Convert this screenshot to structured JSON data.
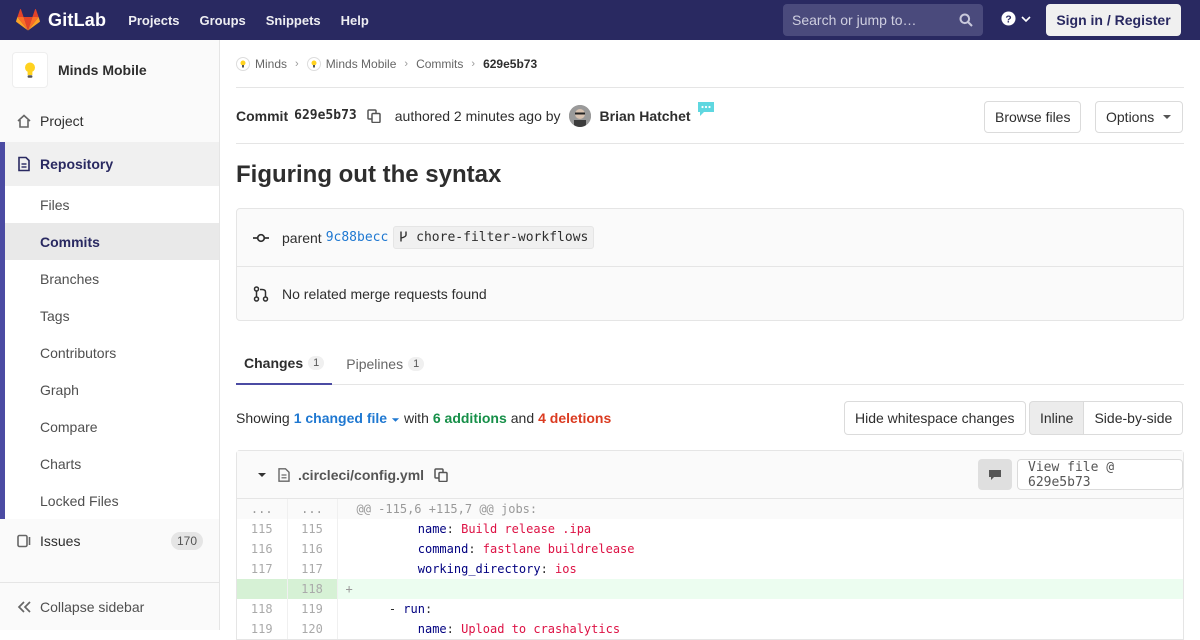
{
  "nav": {
    "brand": "GitLab",
    "links": [
      "Projects",
      "Groups",
      "Snippets",
      "Help"
    ],
    "search_placeholder": "Search or jump to…",
    "signin": "Sign in / Register"
  },
  "sidebar": {
    "project_name": "Minds Mobile",
    "project": "Project",
    "repository": "Repository",
    "repo_items": [
      "Files",
      "Commits",
      "Branches",
      "Tags",
      "Contributors",
      "Graph",
      "Compare",
      "Charts",
      "Locked Files"
    ],
    "active_item": "Commits",
    "issues": "Issues",
    "issues_count": "170",
    "collapse": "Collapse sidebar"
  },
  "breadcrumb": {
    "group": "Minds",
    "project": "Minds Mobile",
    "section": "Commits",
    "current": "629e5b73"
  },
  "commit": {
    "label": "Commit",
    "sha": "629e5b73",
    "authored": "authored 2 minutes ago by",
    "author": "Brian Hatchet",
    "browse_files": "Browse files",
    "options": "Options",
    "title": "Figuring out the syntax",
    "parent_label": "parent",
    "parent_sha": "9c88becc",
    "branch": "chore-filter-workflows",
    "merge_requests": "No related merge requests found"
  },
  "tabs": [
    {
      "label": "Changes",
      "count": "1"
    },
    {
      "label": "Pipelines",
      "count": "1"
    }
  ],
  "summary": {
    "showing": "Showing",
    "changed": "1 changed file",
    "with": "with",
    "additions": "6 additions",
    "and": "and",
    "deletions": "4 deletions",
    "hide_whitespace": "Hide whitespace changes",
    "inline": "Inline",
    "side_by_side": "Side-by-side"
  },
  "file": {
    "path": ".circleci/config.yml",
    "view_file": "View file @ 629e5b73"
  },
  "diff": {
    "hunk_old": "...",
    "hunk_new": "...",
    "hunk": "@@ -115,6 +115,7 @@ jobs:",
    "lines": [
      {
        "old": "115",
        "new": "115",
        "indent": "          ",
        "key": "name",
        "val": "Build release .ipa",
        "type": "ctx"
      },
      {
        "old": "116",
        "new": "116",
        "indent": "          ",
        "key": "command",
        "val": "fastlane buildrelease",
        "type": "ctx"
      },
      {
        "old": "117",
        "new": "117",
        "indent": "          ",
        "key": "working_directory",
        "val": "ios",
        "type": "ctx"
      },
      {
        "old": "",
        "new": "118",
        "indent": "",
        "key": "",
        "val": "",
        "type": "add"
      },
      {
        "old": "118",
        "new": "119",
        "indent": "      - ",
        "key": "run",
        "val": "",
        "type": "ctx"
      },
      {
        "old": "119",
        "new": "120",
        "indent": "          ",
        "key": "name",
        "val": "Upload to crashalytics",
        "type": "ctx"
      }
    ]
  }
}
